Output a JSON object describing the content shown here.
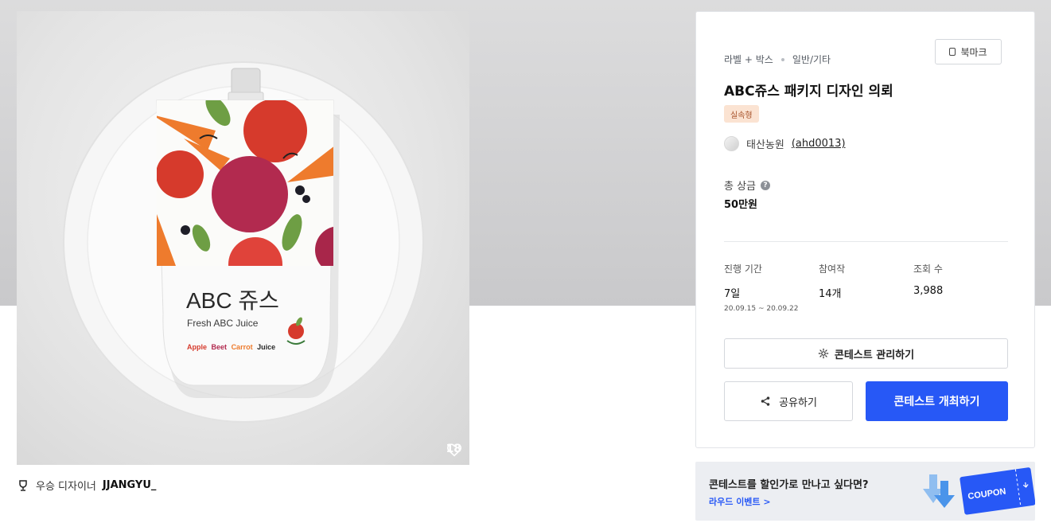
{
  "artwork": {
    "package_title": "ABC 쥬스",
    "package_subtitle": "Fresh ABC Juice",
    "package_tagline_apple": "Apple",
    "package_tagline_beet": "Beet",
    "package_tagline_carrot": "Carrot",
    "package_tagline_juice": "Juice",
    "likes": "18",
    "icon": "heart-icon"
  },
  "winner": {
    "label": "우승 디자이너",
    "name": "JJANGYU_",
    "icon": "trophy-icon"
  },
  "card": {
    "category": "라벨 + 박스",
    "subcategory": "일반/기타",
    "bookmark_label": "북마크",
    "title": "ABC쥬스 패키지 디자인 의뢰",
    "tag": "실속형",
    "client_name": "태산농원",
    "client_handle": "(ahd0013)",
    "prize_label": "총 상금",
    "prize_value": "50만원",
    "stats": {
      "period_label": "진행 기간",
      "period_value": "7일",
      "period_range": "20.09.15 ~ 20.09.22",
      "entries_label": "참여작",
      "entries_value": "14개",
      "views_label": "조회 수",
      "views_value": "3,988"
    },
    "manage_label": "콘테스트 관리하기",
    "share_label": "공유하기",
    "host_label": "콘테스트 개최하기"
  },
  "banner": {
    "headline": "콘테스트를 할인가로 만나고 싶다면?",
    "link": "라우드 이벤트 >",
    "coupon_text": "COUPON"
  },
  "colors": {
    "primary": "#2758f6",
    "tag_bg": "#fbe3d2",
    "tag_text": "#a7522a",
    "band": "#d0d0d2"
  }
}
